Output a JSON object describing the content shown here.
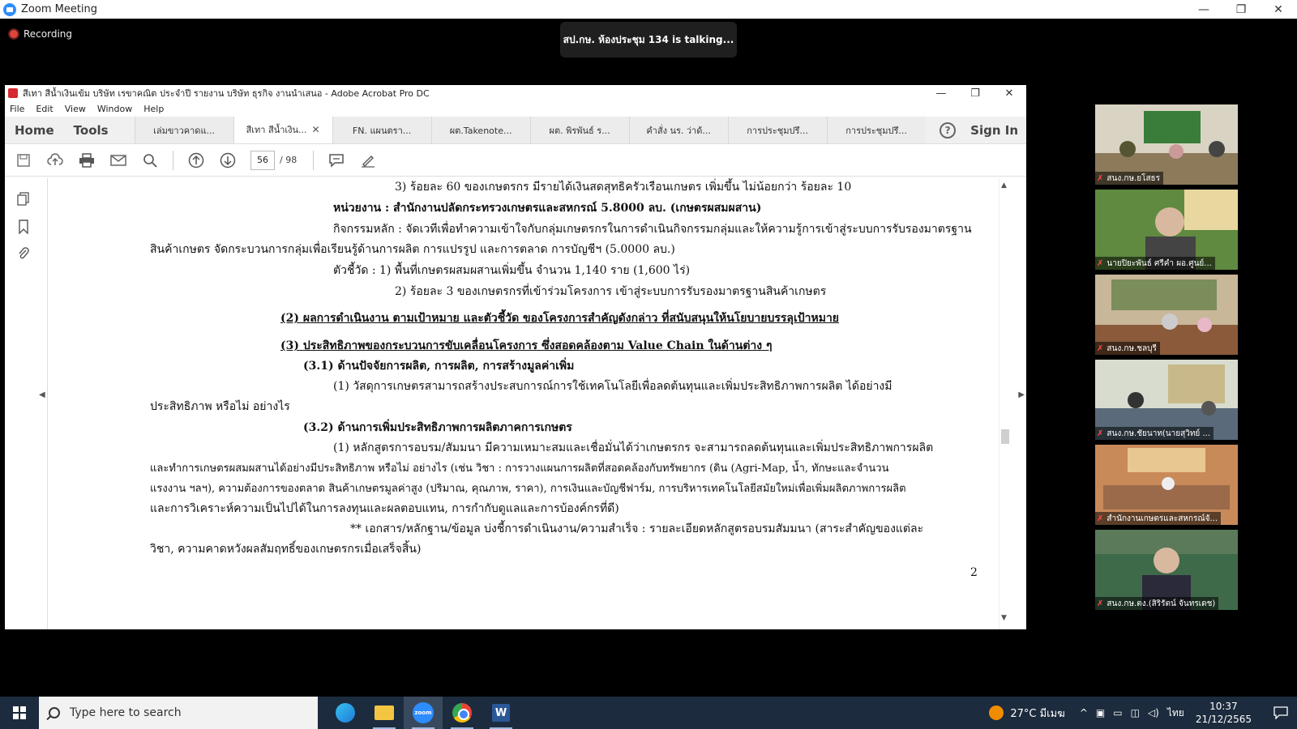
{
  "zoom": {
    "title": "Zoom Meeting",
    "recording_label": "Recording",
    "talking": "สป.กษ. ห้องประชุม 134 is talking..."
  },
  "window_controls": {
    "minimize": "—",
    "maximize": "❐",
    "close": "✕"
  },
  "acrobat": {
    "title": "สีเทา สีน้ำเงินเข้ม บริษัท เรขาคณิต ประจำปี รายงาน บริษัท ธุรกิจ งานนำเสนอ - Adobe Acrobat Pro DC",
    "menu": [
      "File",
      "Edit",
      "View",
      "Window",
      "Help"
    ],
    "nav": {
      "home": "Home",
      "tools": "Tools"
    },
    "tabs": [
      {
        "label": "เล่มขาวคาดแ...",
        "active": false
      },
      {
        "label": "สีเทา สีน้ำเงิน...",
        "active": true
      },
      {
        "label": "FN. แผนตรา...",
        "active": false
      },
      {
        "label": "ผต.Takenote...",
        "active": false
      },
      {
        "label": "ผต. พิรพันธ์ ร...",
        "active": false
      },
      {
        "label": "คำสั่ง นร. ว่าด้...",
        "active": false
      },
      {
        "label": "การประชุมปรึ...",
        "active": false
      },
      {
        "label": "การประชุมปรึ...",
        "active": false
      }
    ],
    "tab_close": "✕",
    "help": "?",
    "sign_in": "Sign In",
    "page_current": "56",
    "page_total": "/ 98"
  },
  "document": {
    "lines": [
      "3) ร้อยละ 60 ของเกษตรกร มีรายได้เงินสดสุทธิครัวเรือนเกษตร เพิ่มขึ้น ไม่น้อยกว่า ร้อยละ 10",
      "หน่วยงาน : สำนักงานปลัดกระทรวงเกษตรและสหกรณ์ 5.8000 ลบ. (เกษตรผสมผสาน)",
      "กิจกรรมหลัก : จัดเวทีเพื่อทำความเข้าใจกับกลุ่มเกษตรกรในการดำเนินกิจกรรมกลุ่มและให้ความรู้การเข้าสู่ระบบการรับรองมาตรฐาน",
      "สินค้าเกษตร จัดกระบวนการกลุ่มเพื่อเรียนรู้ด้านการผลิต การแปรรูป และการตลาด การบัญชีฯ (5.0000 ลบ.)",
      "ตัวชี้วัด :    1) พื้นที่เกษตรผสมผสานเพิ่มขึ้น จำนวน 1,140 ราย (1,600 ไร่)",
      "2) ร้อยละ 3 ของเกษตรกรที่เข้าร่วมโครงการ เข้าสู่ระบบการรับรองมาตรฐานสินค้าเกษตร",
      "(2)  ผลการดำเนินงาน ตามเป้าหมาย และตัวชี้วัด ของโครงการสำคัญดังกล่าว ที่สนับสนุนให้นโยบายบรรลุเป้าหมาย",
      "(3)  ประสิทธิภาพของกระบวนการขับเคลื่อนโครงการ ซึ่งสอดคล้องตาม Value Chain ในด้านต่าง ๆ",
      "(3.1)  ด้านปัจจัยการผลิต, การผลิต, การสร้างมูลค่าเพิ่ม",
      "(1) วัสดุการเกษตรสามารถสร้างประสบการณ์การใช้เทคโนโลยีเพื่อลดต้นทุนและเพิ่มประสิทธิภาพการผลิต ได้อย่างมี",
      "ประสิทธิภาพ หรือไม่ อย่างไร",
      "(3.2)  ด้านการเพิ่มประสิทธิภาพการผลิตภาคการเกษตร",
      "(1) หลักสูตรการอบรม/สัมมนา มีความเหมาะสมและเชื่อมั่นได้ว่าเกษตรกร จะสามารถลดต้นทุนและเพิ่มประสิทธิภาพการผลิต",
      "และทำการเกษตรผสมผสานได้อย่างมีประสิทธิภาพ หรือไม่ อย่างไร (เช่น วิชา : การวางแผนการผลิตที่สอดคล้องกับทรัพยากร (ดิน (Agri-Map, น้ำ, ทักษะและจำนวน",
      "แรงงาน ฯลฯ), ความต้องการของตลาด สินค้าเกษตรมูลค่าสูง (ปริมาณ, คุณภาพ, ราคา), การเงินและบัญชีฟาร์ม, การบริหารเทคโนโลยีสมัยใหม่เพื่อเพิ่มผลิตภาพการผลิต",
      "และการวิเคราะห์ความเป็นไปได้ในการลงทุนและผลตอบแทน, การกำกับดูแลและการบ้องค์กรที่ดี)",
      "** เอกสาร/หลักฐาน/ข้อมูล บ่งชี้การดำเนินงาน/ความสำเร็จ : รายละเอียดหลักสูตรอบรมสัมมนา (สาระสำคัญของแต่ละ",
      "วิชา, ความคาดหวังผลสัมฤทธิ์ของเกษตรกรเมื่อเสร็จสิ้น)"
    ],
    "page_number": "2"
  },
  "participants": [
    {
      "name": "สนง.กษ.ยโสธร"
    },
    {
      "name": "นายปิยะพันธ์ ศรีคำ ผอ.ศูนย์..."
    },
    {
      "name": "สนง.กษ.ชลบุรี"
    },
    {
      "name": "สนง.กษ.ชัยนาท(นายสุวิทย์ ..."
    },
    {
      "name": "สำนักงานเกษตรและสหกรณ์จั..."
    },
    {
      "name": "สนง.กษ.ตง.(สิริรัตน์ จันทรเดช)"
    }
  ],
  "taskbar": {
    "search_placeholder": "Type here to search",
    "zoom_app": "zoom",
    "word_app": "W",
    "weather": "27°C มีเมฆ",
    "language": "ไทย",
    "time": "10:37",
    "date": "21/12/2565"
  }
}
